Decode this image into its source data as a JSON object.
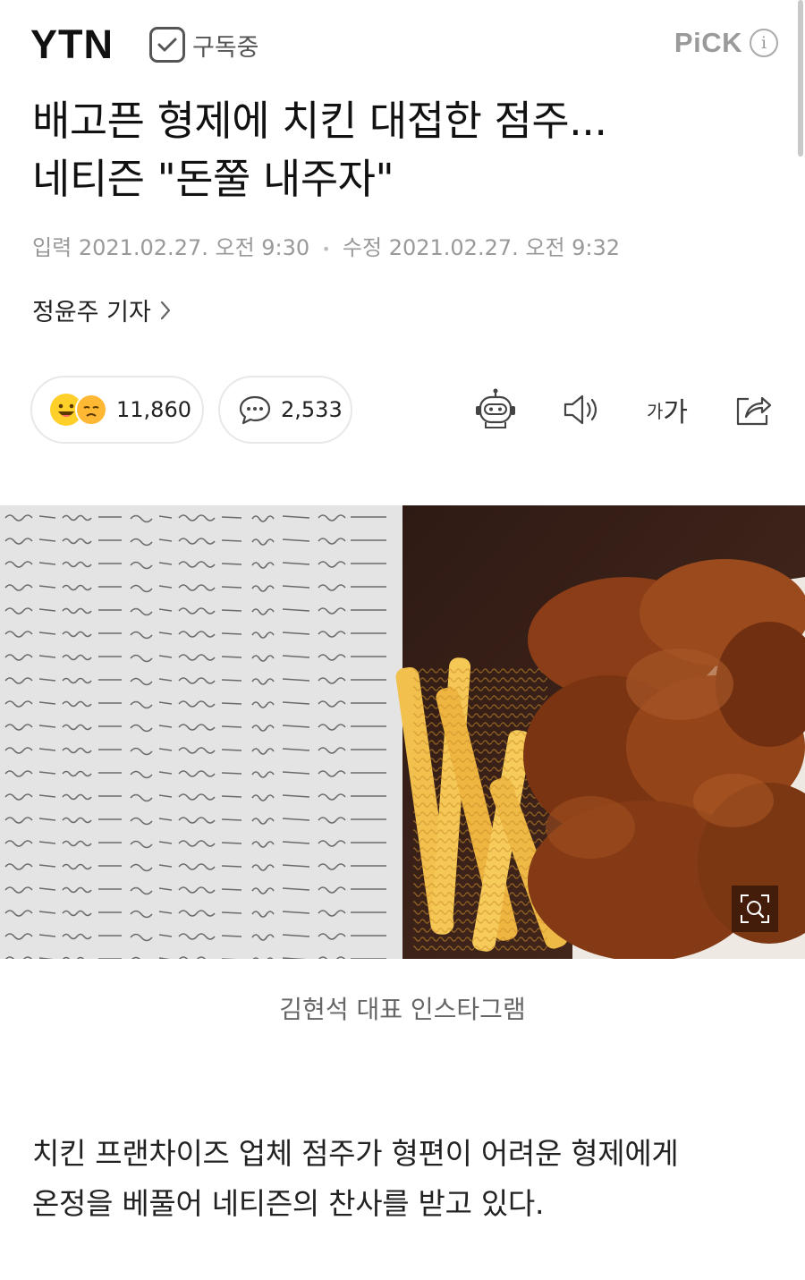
{
  "header": {
    "press_name": "YTN",
    "subscribe_label": "구독중",
    "pick_label": "PiCK",
    "info_icon": "i"
  },
  "article": {
    "title_line1": "배고픈 형제에 치킨 대접한 점주...",
    "title_line2": "네티즌 \"돈쭐 내주자\"",
    "published_label": "입력",
    "published_at": "2021.02.27. 오전 9:30",
    "modified_label": "수정",
    "modified_at": "2021.02.27. 오전 9:32",
    "reporter": "정윤주 기자"
  },
  "stats": {
    "reactions": "11,860",
    "comments": "2,533"
  },
  "toolbar": {
    "icons": [
      "robot-summary-icon",
      "speaker-icon",
      "font-size-icon",
      "share-icon"
    ],
    "font_small": "가",
    "font_large": "가"
  },
  "photo": {
    "caption": "김현석 대표 인스타그램",
    "left_panel": "handwritten-letter",
    "right_panel": "fried-chicken-and-fries"
  },
  "body": {
    "line1": "치킨 프랜차이즈 업체 점주가 형편이 어려운 형제에게",
    "line2": "온정을 베풀어 네티즌의 찬사를 받고 있다."
  },
  "colors": {
    "text_primary": "#111111",
    "text_meta": "#999999",
    "pick_gray": "#9a9a9a",
    "emoji_yellow": "#ffcf2a",
    "letter_paper": "#e4e4e4",
    "photo_background": "#3a221a",
    "chicken_brown": "#8a3d16"
  }
}
